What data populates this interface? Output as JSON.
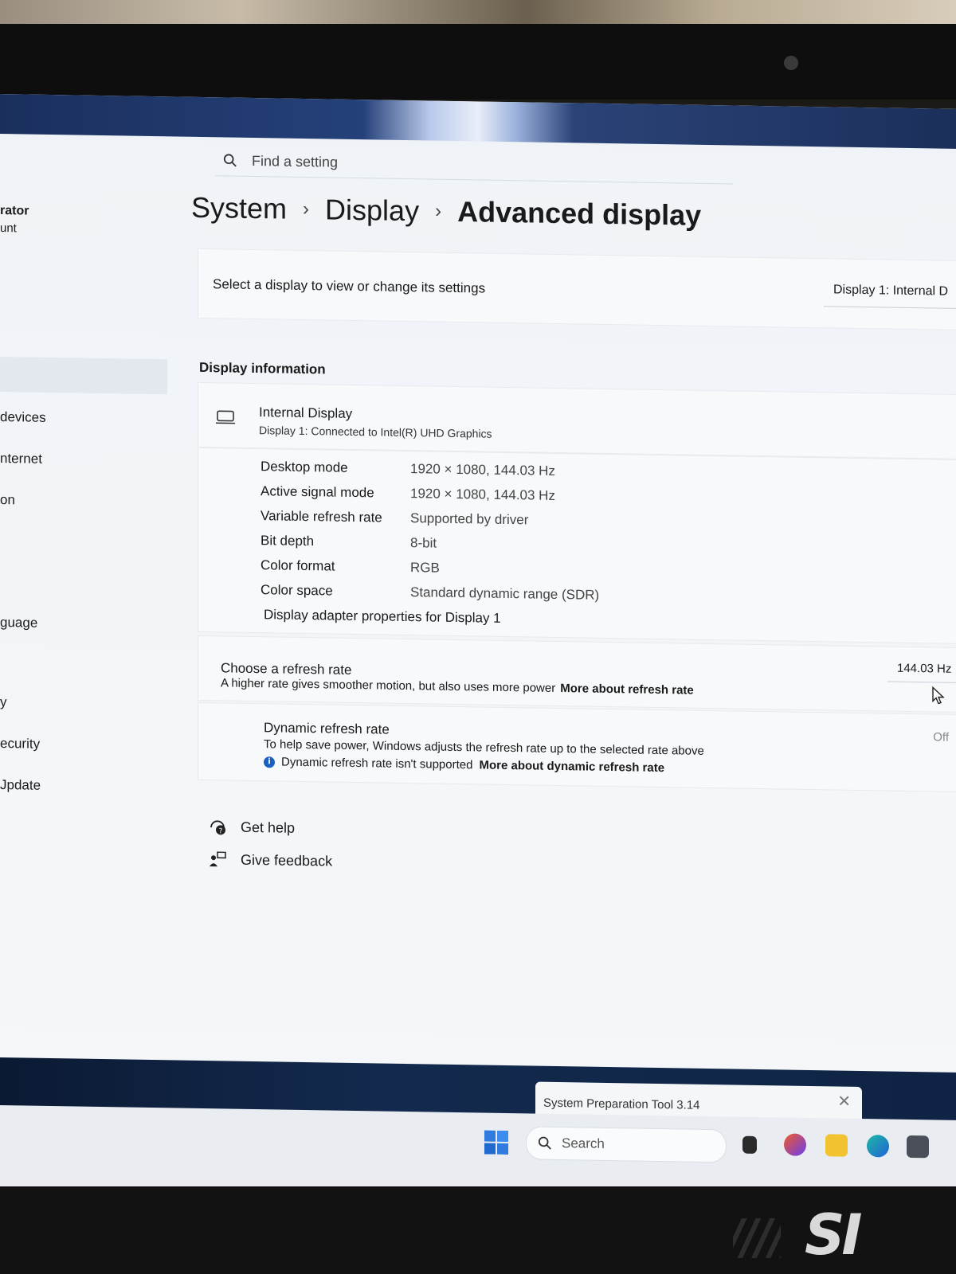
{
  "search": {
    "placeholder": "Find a setting"
  },
  "breadcrumb": {
    "items": [
      "System",
      "Display",
      "Advanced display"
    ],
    "separator": "›"
  },
  "sidebar": {
    "user_name_fragment": "rator",
    "user_type_fragment": "unt",
    "items": [
      "devices",
      "nternet",
      "on",
      "guage",
      "y",
      "ecurity",
      "Jpdate"
    ]
  },
  "select_display": {
    "label": "Select a display to view or change its settings",
    "dropdown_value": "Display 1: Internal D"
  },
  "display_info": {
    "section_title": "Display information",
    "name": "Internal Display",
    "subtitle": "Display 1: Connected to Intel(R) UHD Graphics",
    "rows": [
      {
        "key": "Desktop mode",
        "value": "1920 × 1080, 144.03 Hz"
      },
      {
        "key": "Active signal mode",
        "value": "1920 × 1080, 144.03 Hz"
      },
      {
        "key": "Variable refresh rate",
        "value": "Supported by driver"
      },
      {
        "key": "Bit depth",
        "value": "8-bit"
      },
      {
        "key": "Color format",
        "value": "RGB"
      },
      {
        "key": "Color space",
        "value": "Standard dynamic range (SDR)"
      }
    ],
    "adapter_link": "Display adapter properties for Display 1"
  },
  "refresh_rate": {
    "title": "Choose a refresh rate",
    "description": "A higher rate gives smoother motion, but also uses more power",
    "link": "More about refresh rate",
    "value": "144.03 Hz"
  },
  "dynamic_refresh": {
    "title": "Dynamic refresh rate",
    "description": "To help save power, Windows adjusts the refresh rate up to the selected rate above",
    "warning": "Dynamic refresh rate isn't supported",
    "link": "More about dynamic refresh rate",
    "state": "Off"
  },
  "footer_links": {
    "help": "Get help",
    "feedback": "Give feedback"
  },
  "taskbar": {
    "toast_title": "System Preparation Tool 3.14",
    "search_label": "Search",
    "accent": "#1d5fbf"
  },
  "device_logo": "SI"
}
